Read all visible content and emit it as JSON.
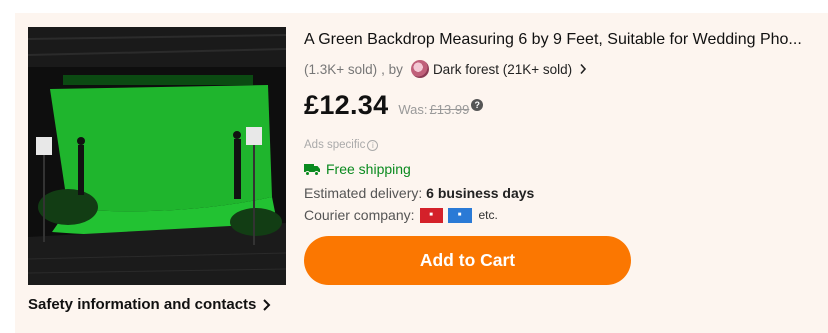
{
  "product": {
    "title": "A Green Backdrop Measuring 6 by 9 Feet, Suitable for Wedding Pho...",
    "sold_count": "(1.3K+ sold)",
    "by_label": ", by",
    "store_name": "Dark forest (21K+ sold)",
    "price": "£12.34",
    "was_label": "Was:",
    "was_price": "£13.99",
    "help_symbol": "?",
    "ads_label": "Ads specific",
    "shipping_label": "Free shipping",
    "delivery_label": "Estimated delivery:",
    "delivery_value": "6 business days",
    "courier_label": "Courier company:",
    "courier_more": "etc.",
    "couriers": [
      {
        "name": "Royal Mail",
        "color": "#d4212a"
      },
      {
        "name": "EVRi",
        "color": "#2a7ad6"
      }
    ],
    "add_to_cart_label": "Add to Cart"
  },
  "safety_link_label": "Safety information and contacts",
  "colors": {
    "accent": "#fb7701",
    "shipping_green": "#0a8a1f",
    "card_bg": "#fdf5ef",
    "backdrop_green": "#1fb52d"
  },
  "icons": [
    "chevron-right-icon",
    "store-avatar",
    "help-icon",
    "info-icon",
    "truck-icon",
    "royal-mail-logo",
    "evri-logo"
  ]
}
